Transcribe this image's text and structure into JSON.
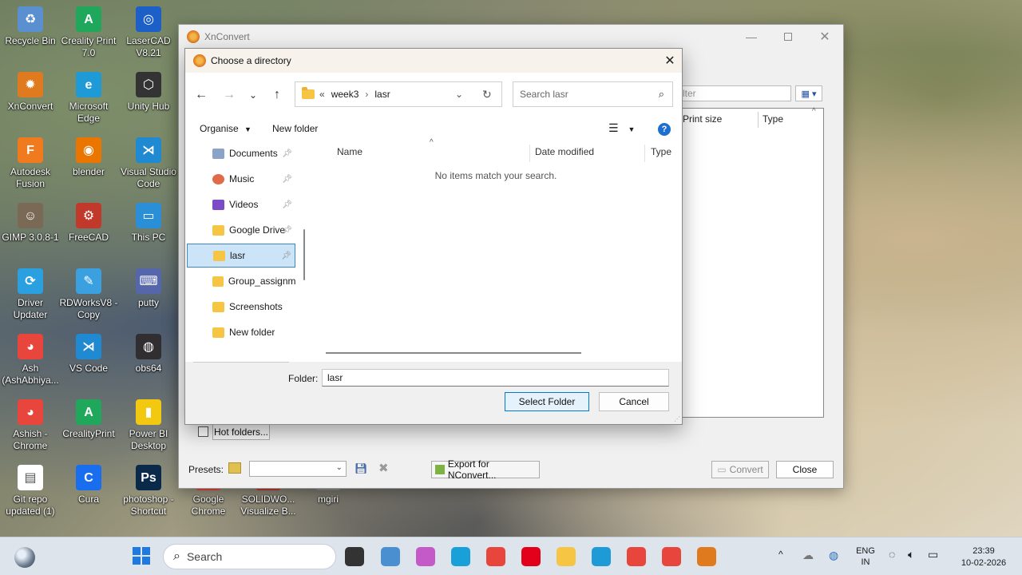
{
  "desktop": {
    "icons": [
      {
        "label": "Recycle Bin",
        "color": "#5a8fd0",
        "glyph": "♻"
      },
      {
        "label": "Creality Print 7.0",
        "color": "#1fa85c",
        "glyph": "A"
      },
      {
        "label": "LaserCAD V8.21",
        "color": "#1b5fc7",
        "glyph": "◎"
      },
      {
        "label": "XnConvert",
        "color": "#e07a1f",
        "glyph": "✹"
      },
      {
        "label": "Microsoft Edge",
        "color": "#1e9ad6",
        "glyph": "e"
      },
      {
        "label": "Unity Hub",
        "color": "#333333",
        "glyph": "⬡"
      },
      {
        "label": "Autodesk Fusion",
        "color": "#f07a1e",
        "glyph": "F"
      },
      {
        "label": "blender",
        "color": "#ea7600",
        "glyph": "◉"
      },
      {
        "label": "Visual Studio Code",
        "color": "#1f8ad2",
        "glyph": "⋊"
      },
      {
        "label": "GIMP 3.0.8-1",
        "color": "#7a6a55",
        "glyph": "☺"
      },
      {
        "label": "FreeCAD",
        "color": "#c0392b",
        "glyph": "⚙"
      },
      {
        "label": "This PC",
        "color": "#2a8fd6",
        "glyph": "▭"
      },
      {
        "label": "Driver Updater",
        "color": "#2aa0e0",
        "glyph": "⟳"
      },
      {
        "label": "RDWorksV8 - Copy",
        "color": "#3aa0e0",
        "glyph": "✎"
      },
      {
        "label": "putty",
        "color": "#5566aa",
        "glyph": "⌨"
      },
      {
        "label": "Ash (AshAbhiya...",
        "color": "#e8453c",
        "glyph": "◕"
      },
      {
        "label": "VS Code",
        "color": "#1f8ad2",
        "glyph": "⋊"
      },
      {
        "label": "obs64",
        "color": "#302e31",
        "glyph": "◍"
      },
      {
        "label": "Ashish - Chrome",
        "color": "#e8453c",
        "glyph": "◕"
      },
      {
        "label": "CrealityPrint",
        "color": "#1fa85c",
        "glyph": "A"
      },
      {
        "label": "Power BI Desktop",
        "color": "#f2c811",
        "glyph": "▮"
      },
      {
        "label": "Git repo updated (1)",
        "color": "#ffffff",
        "glyph": "▤"
      },
      {
        "label": "Cura",
        "color": "#196ef0",
        "glyph": "C"
      },
      {
        "label": "photoshop - Shortcut",
        "color": "#0b2a4a",
        "glyph": "Ps"
      },
      {
        "label": "Google Chrome",
        "color": "#e8453c",
        "glyph": ""
      },
      {
        "label": "SOLIDWO... Visualize B...",
        "color": "#c0392b",
        "glyph": ""
      },
      {
        "label": "mgiri",
        "color": "#888888",
        "glyph": ""
      }
    ]
  },
  "xnconvert": {
    "title": "XnConvert",
    "filter_placeholder": "lter",
    "columns": [
      "Print size",
      "Type"
    ],
    "hot_folders_label": "Hot folders...",
    "presets_label": "Presets:",
    "export_label": "Export for NConvert...",
    "convert_label": "Convert",
    "close_label": "Close"
  },
  "dialog": {
    "title": "Choose a directory",
    "breadcrumb": [
      "week3",
      "lasr"
    ],
    "breadcrumb_prefix": "«",
    "search_placeholder": "Search lasr",
    "organise_label": "Organise",
    "new_folder_label": "New folder",
    "nav_items": [
      {
        "label": "Documents",
        "icon": "documents-icon",
        "pinned": true
      },
      {
        "label": "Music",
        "icon": "music-icon",
        "pinned": true
      },
      {
        "label": "Videos",
        "icon": "videos-icon",
        "pinned": true
      },
      {
        "label": "Google Drive",
        "icon": "folder-icon",
        "pinned": true
      },
      {
        "label": "lasr",
        "icon": "folder-icon",
        "pinned": true,
        "selected": true
      },
      {
        "label": "Group_assignme",
        "icon": "folder-icon",
        "pinned": false
      },
      {
        "label": "Screenshots",
        "icon": "folder-icon",
        "pinned": false
      },
      {
        "label": "New folder",
        "icon": "folder-icon",
        "pinned": false
      }
    ],
    "columns": [
      "Name",
      "Date modified",
      "Type"
    ],
    "empty_message": "No items match your search.",
    "folder_label": "Folder:",
    "folder_value": "lasr",
    "select_label": "Select Folder",
    "cancel_label": "Cancel"
  },
  "taskbar": {
    "search_placeholder": "Search",
    "lang_line1": "ENG",
    "lang_line2": "IN",
    "time": "23:39",
    "date": "10-02-2026"
  }
}
